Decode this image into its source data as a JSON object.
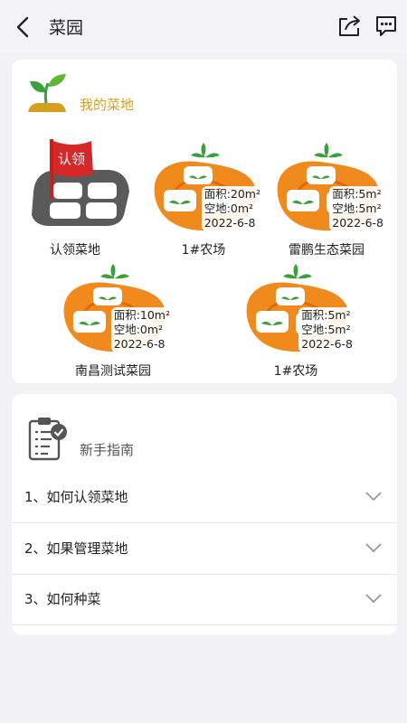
{
  "header": {
    "title": "菜园"
  },
  "my_plots": {
    "title": "我的菜地",
    "claim": {
      "label": "认领菜地",
      "flag_text": "认领"
    },
    "farms": [
      {
        "name": "1#农场",
        "area": "面积:20m²",
        "empty": "空地:0m²",
        "date": "2022-6-8"
      },
      {
        "name": "雷鹏生态菜园",
        "area": "面积:5m²",
        "empty": "空地:5m²",
        "date": "2022-6-8"
      },
      {
        "name": "南昌测试菜园",
        "area": "面积:10m²",
        "empty": "空地:0m²",
        "date": "2022-6-8"
      },
      {
        "name": "1#农场",
        "area": "面积:5m²",
        "empty": "空地:5m²",
        "date": "2022-6-8"
      }
    ]
  },
  "guide": {
    "title": "新手指南",
    "items": [
      {
        "label": "1、如何认领菜地"
      },
      {
        "label": "2、如果管理菜地"
      },
      {
        "label": "3、如何种菜"
      }
    ]
  },
  "colors": {
    "accent": "#d4a020",
    "farm_orange": "#f08a1c",
    "leaf_green": "#3aa03a"
  },
  "icons": [
    "back-icon",
    "share-icon",
    "chat-icon",
    "sprout-icon",
    "flag-icon",
    "clipboard-icon",
    "chevron-down-icon"
  ]
}
